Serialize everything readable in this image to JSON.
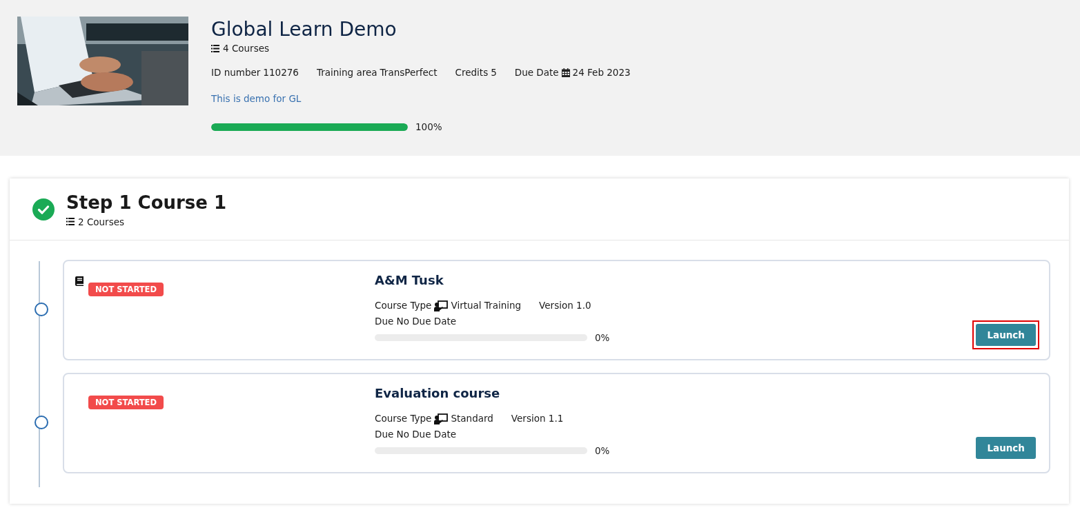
{
  "program": {
    "title": "Global Learn Demo",
    "course_count": "4 Courses",
    "meta": [
      {
        "label": "ID number",
        "value": "110276",
        "kind": "text"
      },
      {
        "label": "Training area",
        "value": "TransPerfect",
        "kind": "text"
      },
      {
        "label": "Credits",
        "value": "5",
        "kind": "text"
      },
      {
        "label": "Due Date",
        "value": "24 Feb 2023",
        "kind": "date"
      }
    ],
    "description": "This is demo for GL",
    "level": 1.0,
    "percent": "100%"
  },
  "step": {
    "title": "Step 1 Course 1",
    "completed": true,
    "course_count": "2 Courses",
    "courses": [
      {
        "title": "A&M Tusk",
        "book_icon": true,
        "status": "NOT STARTED",
        "course_type_label": "Course Type",
        "course_type": "Virtual Training",
        "version": "Version 1.0",
        "due": "Due No Due Date",
        "level": 0,
        "percent": "0%",
        "button": "Launch",
        "highlighted": true
      },
      {
        "title": "Evaluation course",
        "book_icon": false,
        "status": "NOT STARTED",
        "course_type_label": "Course Type",
        "course_type": "Standard",
        "version": "Version 1.1",
        "due": "Due No Due Date",
        "level": 0,
        "percent": "0%",
        "button": "Launch",
        "highlighted": false
      }
    ]
  }
}
